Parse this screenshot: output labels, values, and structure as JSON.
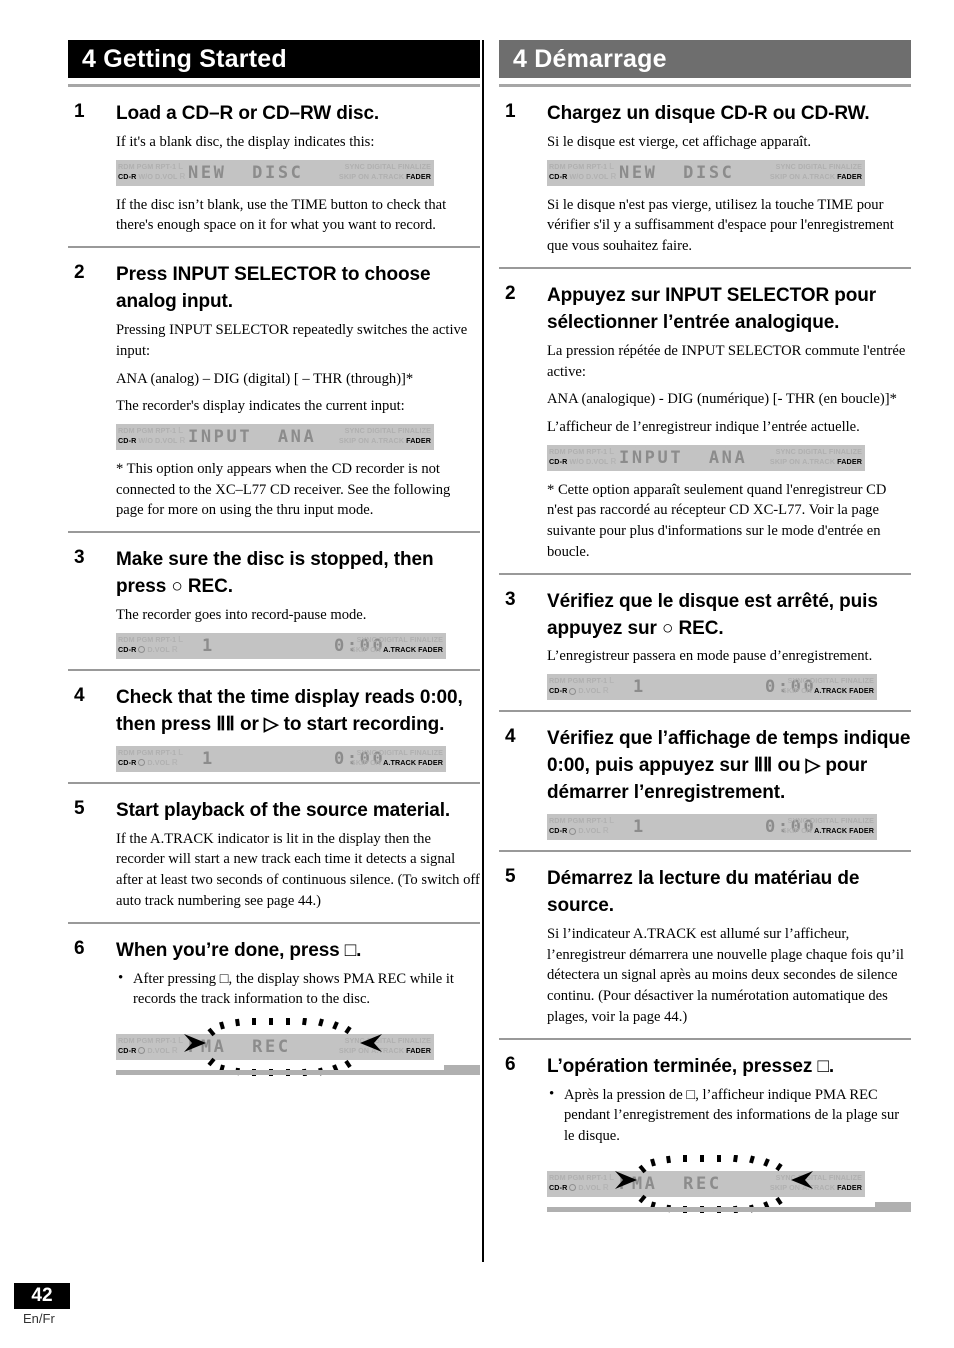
{
  "footer": {
    "page_number": "42",
    "languages": "En/Fr"
  },
  "english": {
    "chapter": "4 Getting Started",
    "steps": [
      {
        "number": "1",
        "heading": "Load a CD–R or CD–RW disc.",
        "intro": "If it's a blank disc, the display indicates this:",
        "after": "If the disc isn’t blank, use the TIME button to check that there's enough space on it for what you want to record."
      },
      {
        "number": "2",
        "heading": "Press INPUT SELECTOR to choose analog input.",
        "p1": "Pressing INPUT SELECTOR repeatedly switches the active input:",
        "p2": "ANA (analog) – DIG (digital) [ – THR (through)]*",
        "p3": "The recorder's display indicates the current input:",
        "p4": "* This option only appears when the CD recorder is not connected to the XC–L77 CD receiver. See the following page for more on using the thru input mode."
      },
      {
        "number": "3",
        "heading": "Make sure the disc is stopped, then press ○ REC.",
        "p1": "The recorder goes into record-pause mode."
      },
      {
        "number": "4",
        "heading": "Check that the time display reads 0:00, then press ⅡⅡ or ▷ to start recording."
      },
      {
        "number": "5",
        "heading": "Start playback of the source material.",
        "p1": "If the A.TRACK indicator is lit in the display then the recorder will start a new track each time it detects a signal after at least two seconds of continuous silence. (To switch off auto track numbering see page 44.)"
      },
      {
        "number": "6",
        "heading": "When you’re done, press □.",
        "p1": "After pressing □, the display shows PMA REC while it records the track information to the disc."
      }
    ]
  },
  "french": {
    "chapter": "4 Démarrage",
    "steps": [
      {
        "number": "1",
        "heading": "Chargez un disque CD-R ou CD-RW.",
        "intro": "Si le disque est vierge, cet affichage apparaît.",
        "after": "Si le disque n'est pas vierge, utilisez la touche TIME pour vérifier s'il y a suffisamment d'espace pour l'enregistrement que vous souhaitez faire."
      },
      {
        "number": "2",
        "heading": "Appuyez sur INPUT SELECTOR pour sélectionner l’entrée analogique.",
        "p1": "La pression répétée de INPUT SELECTOR commute l'entrée active:",
        "p2": "ANA (analogique) - DIG (numérique) [- THR (en boucle)]*",
        "p3": "L’afficheur de l’enregistreur indique l’entrée actuelle.",
        "p4": "* Cette option apparaît seulement quand l'enregistreur CD n'est pas raccordé au récepteur CD XC-L77. Voir la page suivante pour plus d'informations sur le mode d'entrée en boucle."
      },
      {
        "number": "3",
        "heading": "Vérifiez que le disque est arrêté, puis appuyez sur ○ REC.",
        "p1": "L’enregistreur passera en mode pause d’enregistrement."
      },
      {
        "number": "4",
        "heading": "Vérifiez que l’affichage de temps indique 0:00, puis appuyez sur ⅡⅡ ou ▷ pour démarrer l’enregistrement."
      },
      {
        "number": "5",
        "heading": "Démarrez la lecture du matériau de source.",
        "p1": "Si l’indicateur A.TRACK est allumé sur l’afficheur, l’enregistreur démarrera une nouvelle plage chaque fois qu’il détectera un signal après au moins deux secondes de silence continu. (Pour désactiver la numérotation automatique des plages, voir la page 44.)"
      },
      {
        "number": "6",
        "heading": "L’opération terminée, pressez □.",
        "p1": "Après la pression de □, l’afficheur indique PMA REC pendant l’enregistrement des informations de la plage sur le disque."
      }
    ]
  },
  "lcd": {
    "indicators": {
      "rdm": "RDM",
      "pgm": "PGM",
      "rpt1": "RPT-1",
      "cdr": "CD-R",
      "wo": "W/O",
      "dvol": "D.VOL",
      "l": "L",
      "r": "R",
      "sync": "SYNC",
      "digital": "DIGITAL",
      "finalize": "FINALIZE",
      "skip": "SKIP",
      "on": "ON",
      "atrack": "A.TRACK",
      "fader": "FADER"
    },
    "panels": {
      "new_disc": {
        "text": "NEW  DISC"
      },
      "input_ana": {
        "text": "INPUT  ANA"
      },
      "time": {
        "track": "1",
        "time": "0:00"
      },
      "pma_rec": {
        "text": "PMA  REC"
      }
    }
  }
}
